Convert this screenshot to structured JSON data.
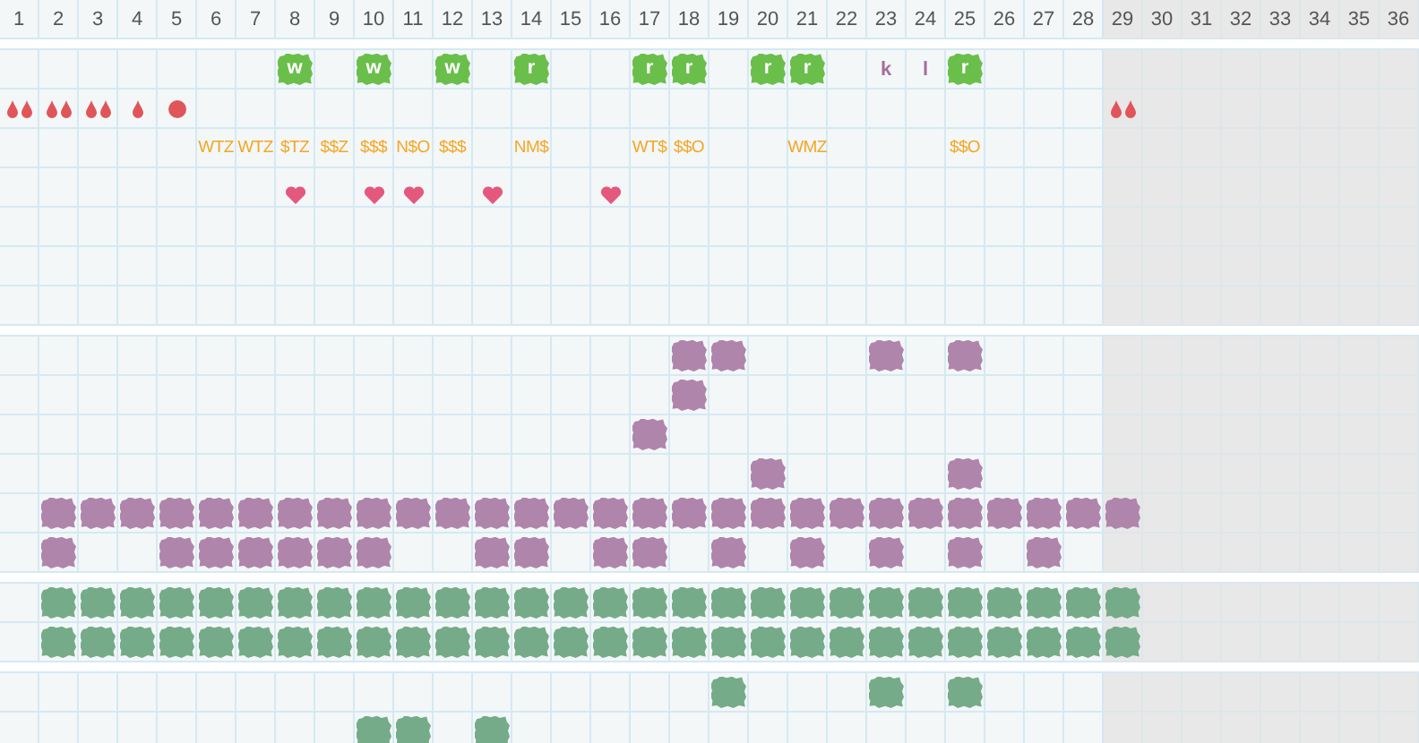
{
  "columns": [
    {
      "label": "1",
      "shaded": false
    },
    {
      "label": "2",
      "shaded": false
    },
    {
      "label": "3",
      "shaded": false
    },
    {
      "label": "4",
      "shaded": false
    },
    {
      "label": "5",
      "shaded": false
    },
    {
      "label": "6",
      "shaded": false
    },
    {
      "label": "7",
      "shaded": false
    },
    {
      "label": "8",
      "shaded": false
    },
    {
      "label": "9",
      "shaded": false
    },
    {
      "label": "10",
      "shaded": false
    },
    {
      "label": "11",
      "shaded": false
    },
    {
      "label": "12",
      "shaded": false
    },
    {
      "label": "13",
      "shaded": false
    },
    {
      "label": "14",
      "shaded": false
    },
    {
      "label": "15",
      "shaded": false
    },
    {
      "label": "16",
      "shaded": false
    },
    {
      "label": "17",
      "shaded": false
    },
    {
      "label": "18",
      "shaded": false
    },
    {
      "label": "19",
      "shaded": false
    },
    {
      "label": "20",
      "shaded": false
    },
    {
      "label": "21",
      "shaded": false
    },
    {
      "label": "22",
      "shaded": false
    },
    {
      "label": "23",
      "shaded": false
    },
    {
      "label": "24",
      "shaded": false
    },
    {
      "label": "25",
      "shaded": false
    },
    {
      "label": "26",
      "shaded": false
    },
    {
      "label": "27",
      "shaded": false
    },
    {
      "label": "28",
      "shaded": false
    },
    {
      "label": "29",
      "shaded": true
    },
    {
      "label": "30",
      "shaded": true
    },
    {
      "label": "31",
      "shaded": true
    },
    {
      "label": "32",
      "shaded": true
    },
    {
      "label": "33",
      "shaded": true
    },
    {
      "label": "34",
      "shaded": true
    },
    {
      "label": "35",
      "shaded": true
    },
    {
      "label": "36",
      "shaded": true
    }
  ],
  "sections": [
    {
      "color": "#6abf4b",
      "rows": [
        {
          "cells": [
            {
              "kind": "none"
            },
            {
              "kind": "none"
            },
            {
              "kind": "none"
            },
            {
              "kind": "none"
            },
            {
              "kind": "none"
            },
            {
              "kind": "none"
            },
            {
              "kind": "none"
            },
            {
              "kind": "badge",
              "text": "w"
            },
            {
              "kind": "none"
            },
            {
              "kind": "badge",
              "text": "w"
            },
            {
              "kind": "none"
            },
            {
              "kind": "badge",
              "text": "w"
            },
            {
              "kind": "none"
            },
            {
              "kind": "badge",
              "text": "r"
            },
            {
              "kind": "none"
            },
            {
              "kind": "none"
            },
            {
              "kind": "badge",
              "text": "r"
            },
            {
              "kind": "badge",
              "text": "r"
            },
            {
              "kind": "none"
            },
            {
              "kind": "badge",
              "text": "r"
            },
            {
              "kind": "badge",
              "text": "r"
            },
            {
              "kind": "none"
            },
            {
              "kind": "letter",
              "text": "k"
            },
            {
              "kind": "letter",
              "text": "l"
            },
            {
              "kind": "badge",
              "text": "r"
            }
          ]
        },
        {
          "cells": [
            {
              "kind": "double-drop"
            },
            {
              "kind": "double-drop"
            },
            {
              "kind": "double-drop"
            },
            {
              "kind": "drop"
            },
            {
              "kind": "dot"
            },
            {
              "kind": "none"
            },
            {
              "kind": "none"
            },
            {
              "kind": "none"
            },
            {
              "kind": "none"
            },
            {
              "kind": "none"
            },
            {
              "kind": "none"
            },
            {
              "kind": "none"
            },
            {
              "kind": "none"
            },
            {
              "kind": "none"
            },
            {
              "kind": "none"
            },
            {
              "kind": "none"
            },
            {
              "kind": "none"
            },
            {
              "kind": "none"
            },
            {
              "kind": "none"
            },
            {
              "kind": "none"
            },
            {
              "kind": "none"
            },
            {
              "kind": "none"
            },
            {
              "kind": "none"
            },
            {
              "kind": "none"
            },
            {
              "kind": "none"
            },
            {
              "kind": "none"
            },
            {
              "kind": "none"
            },
            {
              "kind": "none"
            },
            {
              "kind": "double-drop"
            }
          ]
        },
        {
          "cells": [
            {
              "kind": "none"
            },
            {
              "kind": "none"
            },
            {
              "kind": "none"
            },
            {
              "kind": "none"
            },
            {
              "kind": "none"
            },
            {
              "kind": "code",
              "text": "WTZ"
            },
            {
              "kind": "code",
              "text": "WTZ"
            },
            {
              "kind": "code",
              "text": "$TZ"
            },
            {
              "kind": "code",
              "text": "$$Z"
            },
            {
              "kind": "code",
              "text": "$$$"
            },
            {
              "kind": "code",
              "text": "N$O"
            },
            {
              "kind": "code",
              "text": "$$$"
            },
            {
              "kind": "none"
            },
            {
              "kind": "code",
              "text": "NM$"
            },
            {
              "kind": "none"
            },
            {
              "kind": "none"
            },
            {
              "kind": "code",
              "text": "WT$"
            },
            {
              "kind": "code",
              "text": "$$O"
            },
            {
              "kind": "none"
            },
            {
              "kind": "none"
            },
            {
              "kind": "code",
              "text": "WMZ"
            },
            {
              "kind": "none"
            },
            {
              "kind": "none"
            },
            {
              "kind": "none"
            },
            {
              "kind": "code",
              "text": "$$O"
            }
          ]
        },
        {
          "cells": [
            {
              "kind": "none"
            },
            {
              "kind": "none"
            },
            {
              "kind": "none"
            },
            {
              "kind": "none"
            },
            {
              "kind": "none"
            },
            {
              "kind": "none"
            },
            {
              "kind": "none"
            },
            {
              "kind": "heart"
            },
            {
              "kind": "none"
            },
            {
              "kind": "heart"
            },
            {
              "kind": "heart"
            },
            {
              "kind": "none"
            },
            {
              "kind": "heart"
            },
            {
              "kind": "none"
            },
            {
              "kind": "none"
            },
            {
              "kind": "heart"
            }
          ]
        },
        {},
        {},
        {}
      ]
    },
    {
      "color": "#b085ab",
      "rows": [
        {
          "cells": [
            {
              "kind": "none"
            },
            {
              "kind": "none"
            },
            {
              "kind": "none"
            },
            {
              "kind": "none"
            },
            {
              "kind": "none"
            },
            {
              "kind": "none"
            },
            {
              "kind": "none"
            },
            {
              "kind": "none"
            },
            {
              "kind": "none"
            },
            {
              "kind": "none"
            },
            {
              "kind": "none"
            },
            {
              "kind": "none"
            },
            {
              "kind": "none"
            },
            {
              "kind": "none"
            },
            {
              "kind": "none"
            },
            {
              "kind": "none"
            },
            {
              "kind": "none"
            },
            {
              "kind": "blob"
            },
            {
              "kind": "blob"
            },
            {
              "kind": "none"
            },
            {
              "kind": "none"
            },
            {
              "kind": "none"
            },
            {
              "kind": "blob"
            },
            {
              "kind": "none"
            },
            {
              "kind": "blob"
            }
          ]
        },
        {
          "cells": [
            {
              "kind": "none"
            },
            {
              "kind": "none"
            },
            {
              "kind": "none"
            },
            {
              "kind": "none"
            },
            {
              "kind": "none"
            },
            {
              "kind": "none"
            },
            {
              "kind": "none"
            },
            {
              "kind": "none"
            },
            {
              "kind": "none"
            },
            {
              "kind": "none"
            },
            {
              "kind": "none"
            },
            {
              "kind": "none"
            },
            {
              "kind": "none"
            },
            {
              "kind": "none"
            },
            {
              "kind": "none"
            },
            {
              "kind": "none"
            },
            {
              "kind": "none"
            },
            {
              "kind": "blob"
            }
          ]
        },
        {
          "cells": [
            {
              "kind": "none"
            },
            {
              "kind": "none"
            },
            {
              "kind": "none"
            },
            {
              "kind": "none"
            },
            {
              "kind": "none"
            },
            {
              "kind": "none"
            },
            {
              "kind": "none"
            },
            {
              "kind": "none"
            },
            {
              "kind": "none"
            },
            {
              "kind": "none"
            },
            {
              "kind": "none"
            },
            {
              "kind": "none"
            },
            {
              "kind": "none"
            },
            {
              "kind": "none"
            },
            {
              "kind": "none"
            },
            {
              "kind": "none"
            },
            {
              "kind": "blob"
            }
          ]
        },
        {
          "cells": [
            {
              "kind": "none"
            },
            {
              "kind": "none"
            },
            {
              "kind": "none"
            },
            {
              "kind": "none"
            },
            {
              "kind": "none"
            },
            {
              "kind": "none"
            },
            {
              "kind": "none"
            },
            {
              "kind": "none"
            },
            {
              "kind": "none"
            },
            {
              "kind": "none"
            },
            {
              "kind": "none"
            },
            {
              "kind": "none"
            },
            {
              "kind": "none"
            },
            {
              "kind": "none"
            },
            {
              "kind": "none"
            },
            {
              "kind": "none"
            },
            {
              "kind": "none"
            },
            {
              "kind": "none"
            },
            {
              "kind": "none"
            },
            {
              "kind": "blob"
            },
            {
              "kind": "none"
            },
            {
              "kind": "none"
            },
            {
              "kind": "none"
            },
            {
              "kind": "none"
            },
            {
              "kind": "blob"
            }
          ]
        },
        {
          "cells": [
            {
              "kind": "none"
            },
            {
              "kind": "blob"
            },
            {
              "kind": "blob"
            },
            {
              "kind": "blob"
            },
            {
              "kind": "blob"
            },
            {
              "kind": "blob"
            },
            {
              "kind": "blob"
            },
            {
              "kind": "blob"
            },
            {
              "kind": "blob"
            },
            {
              "kind": "blob"
            },
            {
              "kind": "blob"
            },
            {
              "kind": "blob"
            },
            {
              "kind": "blob"
            },
            {
              "kind": "blob"
            },
            {
              "kind": "blob"
            },
            {
              "kind": "blob"
            },
            {
              "kind": "blob"
            },
            {
              "kind": "blob"
            },
            {
              "kind": "blob"
            },
            {
              "kind": "blob"
            },
            {
              "kind": "blob"
            },
            {
              "kind": "blob"
            },
            {
              "kind": "blob"
            },
            {
              "kind": "blob"
            },
            {
              "kind": "blob"
            },
            {
              "kind": "blob"
            },
            {
              "kind": "blob"
            },
            {
              "kind": "blob"
            },
            {
              "kind": "blob"
            }
          ]
        },
        {
          "cells": [
            {
              "kind": "none"
            },
            {
              "kind": "blob"
            },
            {
              "kind": "none"
            },
            {
              "kind": "none"
            },
            {
              "kind": "blob"
            },
            {
              "kind": "blob"
            },
            {
              "kind": "blob"
            },
            {
              "kind": "blob"
            },
            {
              "kind": "blob"
            },
            {
              "kind": "blob"
            },
            {
              "kind": "none"
            },
            {
              "kind": "none"
            },
            {
              "kind": "blob"
            },
            {
              "kind": "blob"
            },
            {
              "kind": "none"
            },
            {
              "kind": "blob"
            },
            {
              "kind": "blob"
            },
            {
              "kind": "none"
            },
            {
              "kind": "blob"
            },
            {
              "kind": "none"
            },
            {
              "kind": "blob"
            },
            {
              "kind": "none"
            },
            {
              "kind": "blob"
            },
            {
              "kind": "none"
            },
            {
              "kind": "blob"
            },
            {
              "kind": "none"
            },
            {
              "kind": "blob"
            }
          ]
        }
      ]
    },
    {
      "color": "#76ab89",
      "rows": [
        {
          "cells": [
            {
              "kind": "none"
            },
            {
              "kind": "blob"
            },
            {
              "kind": "blob"
            },
            {
              "kind": "blob"
            },
            {
              "kind": "blob"
            },
            {
              "kind": "blob"
            },
            {
              "kind": "blob"
            },
            {
              "kind": "blob"
            },
            {
              "kind": "blob"
            },
            {
              "kind": "blob"
            },
            {
              "kind": "blob"
            },
            {
              "kind": "blob"
            },
            {
              "kind": "blob"
            },
            {
              "kind": "blob"
            },
            {
              "kind": "blob"
            },
            {
              "kind": "blob"
            },
            {
              "kind": "blob"
            },
            {
              "kind": "blob"
            },
            {
              "kind": "blob"
            },
            {
              "kind": "blob"
            },
            {
              "kind": "blob"
            },
            {
              "kind": "blob"
            },
            {
              "kind": "blob"
            },
            {
              "kind": "blob"
            },
            {
              "kind": "blob"
            },
            {
              "kind": "blob"
            },
            {
              "kind": "blob"
            },
            {
              "kind": "blob"
            },
            {
              "kind": "blob"
            }
          ]
        },
        {
          "cells": [
            {
              "kind": "none"
            },
            {
              "kind": "blob"
            },
            {
              "kind": "blob"
            },
            {
              "kind": "blob"
            },
            {
              "kind": "blob"
            },
            {
              "kind": "blob"
            },
            {
              "kind": "blob"
            },
            {
              "kind": "blob"
            },
            {
              "kind": "blob"
            },
            {
              "kind": "blob"
            },
            {
              "kind": "blob"
            },
            {
              "kind": "blob"
            },
            {
              "kind": "blob"
            },
            {
              "kind": "blob"
            },
            {
              "kind": "blob"
            },
            {
              "kind": "blob"
            },
            {
              "kind": "blob"
            },
            {
              "kind": "blob"
            },
            {
              "kind": "blob"
            },
            {
              "kind": "blob"
            },
            {
              "kind": "blob"
            },
            {
              "kind": "blob"
            },
            {
              "kind": "blob"
            },
            {
              "kind": "blob"
            },
            {
              "kind": "blob"
            },
            {
              "kind": "blob"
            },
            {
              "kind": "blob"
            },
            {
              "kind": "blob"
            },
            {
              "kind": "blob"
            }
          ]
        }
      ]
    },
    {
      "color": "#76ab89",
      "rows": [
        {
          "cells": [
            {
              "kind": "none"
            },
            {
              "kind": "none"
            },
            {
              "kind": "none"
            },
            {
              "kind": "none"
            },
            {
              "kind": "none"
            },
            {
              "kind": "none"
            },
            {
              "kind": "none"
            },
            {
              "kind": "none"
            },
            {
              "kind": "none"
            },
            {
              "kind": "none"
            },
            {
              "kind": "none"
            },
            {
              "kind": "none"
            },
            {
              "kind": "none"
            },
            {
              "kind": "none"
            },
            {
              "kind": "none"
            },
            {
              "kind": "none"
            },
            {
              "kind": "none"
            },
            {
              "kind": "none"
            },
            {
              "kind": "blob"
            },
            {
              "kind": "none"
            },
            {
              "kind": "none"
            },
            {
              "kind": "none"
            },
            {
              "kind": "blob"
            },
            {
              "kind": "none"
            },
            {
              "kind": "blob"
            }
          ]
        },
        {
          "cells": [
            {
              "kind": "none"
            },
            {
              "kind": "none"
            },
            {
              "kind": "none"
            },
            {
              "kind": "none"
            },
            {
              "kind": "none"
            },
            {
              "kind": "none"
            },
            {
              "kind": "none"
            },
            {
              "kind": "none"
            },
            {
              "kind": "none"
            },
            {
              "kind": "blob"
            },
            {
              "kind": "blob"
            },
            {
              "kind": "none"
            },
            {
              "kind": "blob"
            }
          ]
        }
      ]
    }
  ]
}
